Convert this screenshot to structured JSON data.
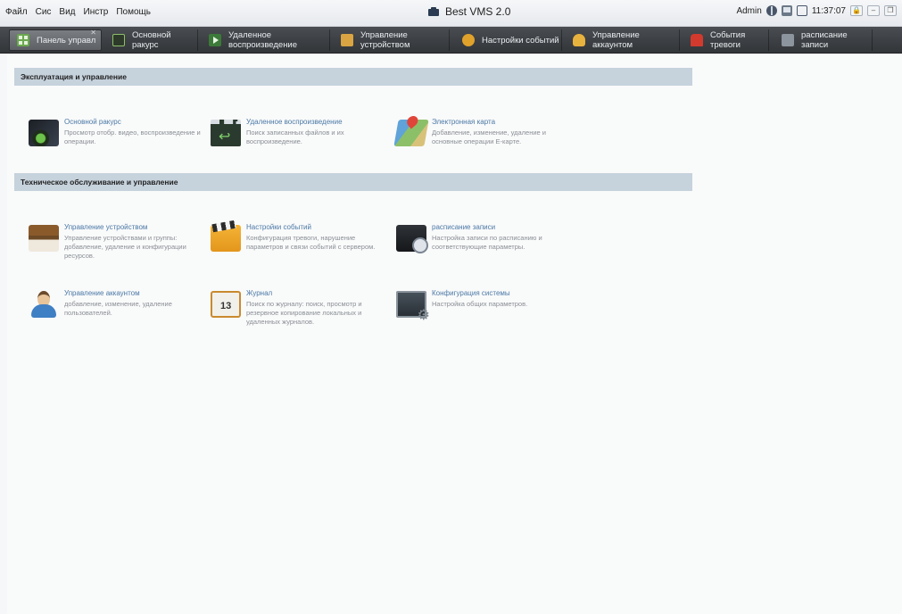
{
  "menu": [
    "Файл",
    "Сис",
    "Вид",
    "Инстр",
    "Помощь"
  ],
  "app_title": "Best VMS 2.0",
  "status": {
    "user": "Admin",
    "time": "11:37:07"
  },
  "tabs": [
    {
      "label": "Панель управл",
      "icon": "dashboard-icon",
      "active": true
    },
    {
      "label": "Основной ракурс",
      "icon": "camera-icon"
    },
    {
      "label": "Удаленное воспроизведение",
      "icon": "playback-icon"
    },
    {
      "label": "Управление устройством",
      "icon": "device-icon"
    },
    {
      "label": "Настройки событий",
      "icon": "event-icon"
    },
    {
      "label": "Управление аккаунтом",
      "icon": "user-icon"
    },
    {
      "label": "События тревоги",
      "icon": "alarm-icon"
    },
    {
      "label": "расписание записи",
      "icon": "schedule-icon"
    }
  ],
  "sections": [
    {
      "title": "Эксплуатация и управление",
      "cards": [
        {
          "title": "Основной ракурс",
          "desc": "Просмотр отобр. видео, воспроизведение и операции.",
          "icon": "main-view-icon"
        },
        {
          "title": "Удаленное воспроизведение",
          "desc": "Поиск записанных файлов и их воспроизведение.",
          "icon": "remote-playback-icon"
        },
        {
          "title": "Электронная карта",
          "desc": "Добавление, изменение, удаление и основные операции Е-карте.",
          "icon": "emap-icon"
        }
      ]
    },
    {
      "title": "Техническое обслуживание и управление",
      "cards": [
        {
          "title": "Управление устройством",
          "desc": "Управление устройствами и группы: добавление, удаление и конфигурации ресурсов.",
          "icon": "device-management-icon"
        },
        {
          "title": "Настройки событий",
          "desc": "Конфигурация тревоги, нарушение параметров и связи событий с сервером.",
          "icon": "event-settings-icon"
        },
        {
          "title": "расписание записи",
          "desc": "Настройка записи по расписанию и соответствующие параметры.",
          "icon": "record-schedule-icon"
        },
        {
          "title": "Управление аккаунтом",
          "desc": "добавление, изменение, удаление пользователей.",
          "icon": "account-icon"
        },
        {
          "title": "Журнал",
          "desc": "Поиск по журналу: поиск, просмотр и резервное копирование локальных и удаленных журналов.",
          "icon": "journal-icon"
        },
        {
          "title": "Конфигурация системы",
          "desc": "Настройка общих параметров.",
          "icon": "system-config-icon"
        }
      ]
    }
  ]
}
